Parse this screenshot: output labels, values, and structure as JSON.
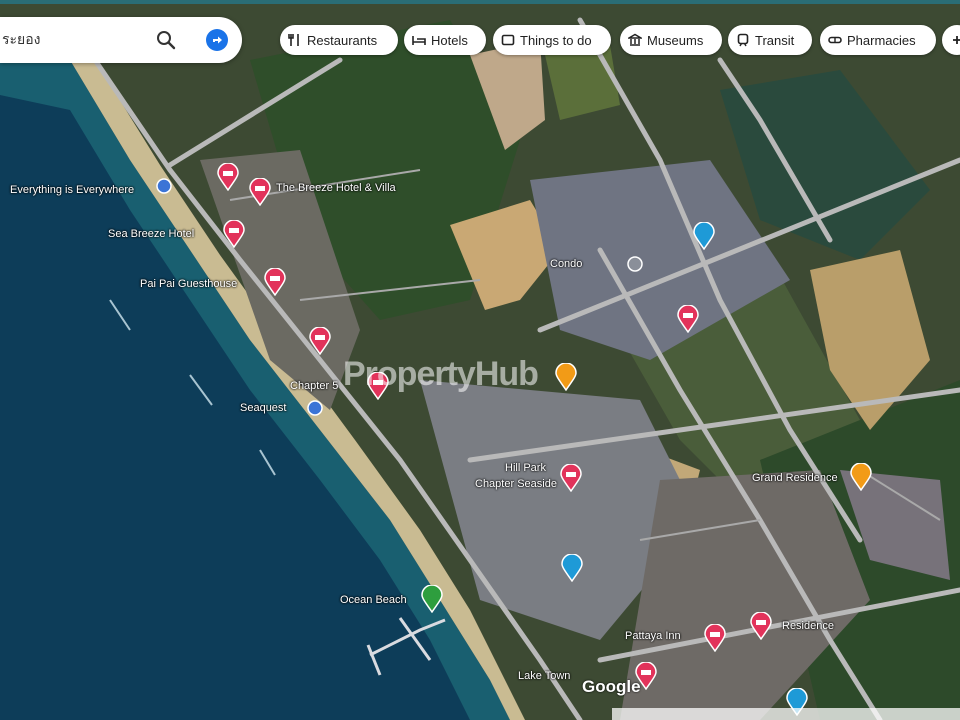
{
  "search": {
    "value": "ระยอง",
    "placeholder": "ระยอง"
  },
  "chips": [
    {
      "label": "Restaurants",
      "icon": "fork-knife-icon"
    },
    {
      "label": "Hotels",
      "icon": "bed-icon"
    },
    {
      "label": "Things to do",
      "icon": "ticket-icon"
    },
    {
      "label": "Museums",
      "icon": "museum-icon"
    },
    {
      "label": "Transit",
      "icon": "train-icon"
    },
    {
      "label": "Pharmacies",
      "icon": "pill-icon"
    }
  ],
  "labels": [
    "Everything is Everywhere",
    "The Breeze Hotel & Villa",
    "Sea Breeze Hotel",
    "Pai Pai Guesthouse",
    "Chapter 5",
    "Seaquest",
    "Condo",
    "Hill Park",
    "Chapter Seaside",
    "Ocean Beach",
    "Grand Residence",
    "Pattaya Inn",
    "Residence",
    "Lake Town"
  ],
  "watermark": "PropertyHub",
  "google_logo": "Google",
  "colors": {
    "pin_red": "#e2335b",
    "pin_orange": "#f29b17",
    "pin_blue": "#1e9ad7",
    "pin_green": "#2e9e3e",
    "sea": "#0b3b55"
  }
}
